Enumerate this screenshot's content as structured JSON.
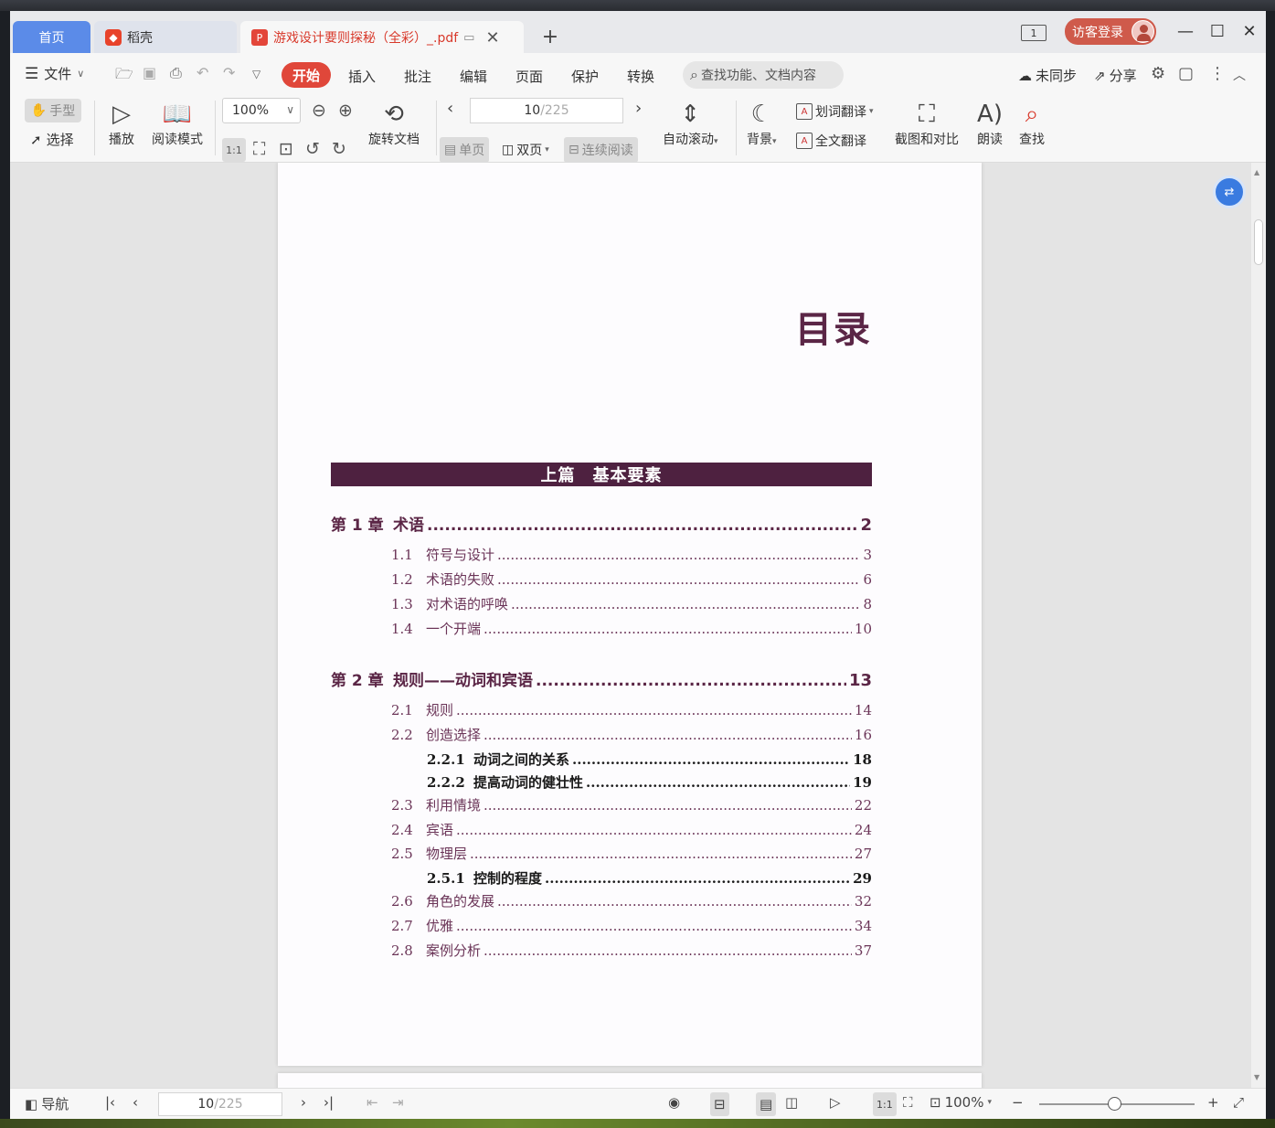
{
  "titlebar": {
    "home_tab": "首页",
    "daoke_tab": "稻壳",
    "doc_tab": "游戏设计要则探秘（全彩）_.pdf",
    "page_count_badge": "1",
    "login_label": "访客登录"
  },
  "menu": {
    "file": "文件",
    "tabs": [
      "开始",
      "插入",
      "批注",
      "编辑",
      "页面",
      "保护",
      "转换"
    ],
    "search_placeholder": "查找功能、文档内容",
    "sync": "未同步",
    "share": "分享"
  },
  "toolbar": {
    "hand": "手型",
    "select": "选择",
    "play": "播放",
    "read_mode": "阅读模式",
    "zoom": "100%",
    "fit_label": "1:1",
    "rotate": "旋转文档",
    "page_current": "10",
    "page_total": "/225",
    "single": "单页",
    "double": "双页",
    "continuous": "连续阅读",
    "autoscroll": "自动滚动",
    "background": "背景",
    "word_translate": "划词翻译",
    "full_translate": "全文翻译",
    "screenshot_compare": "截图和对比",
    "read_aloud": "朗读",
    "find": "查找"
  },
  "document": {
    "toc_title": "目录",
    "part_title": "上篇　基本要素",
    "chapters": [
      {
        "num": "第 1 章",
        "title": "术语",
        "page": "2"
      },
      {
        "num": "第 2 章",
        "title": "规则——动词和宾语",
        "page": "13"
      }
    ],
    "sections": [
      {
        "num": "1.1",
        "title": "符号与设计",
        "page": "3"
      },
      {
        "num": "1.2",
        "title": "术语的失败",
        "page": "6"
      },
      {
        "num": "1.3",
        "title": "对术语的呼唤",
        "page": "8"
      },
      {
        "num": "1.4",
        "title": "一个开端",
        "page": "10"
      },
      {
        "num": "2.1",
        "title": "规则",
        "page": "14"
      },
      {
        "num": "2.2",
        "title": "创造选择",
        "page": "16"
      },
      {
        "num": "2.2.1",
        "title": "动词之间的关系",
        "page": "18"
      },
      {
        "num": "2.2.2",
        "title": "提高动词的健壮性",
        "page": "19"
      },
      {
        "num": "2.3",
        "title": "利用情境",
        "page": "22"
      },
      {
        "num": "2.4",
        "title": "宾语",
        "page": "24"
      },
      {
        "num": "2.5",
        "title": "物理层",
        "page": "27"
      },
      {
        "num": "2.5.1",
        "title": "控制的程度",
        "page": "29"
      },
      {
        "num": "2.6",
        "title": "角色的发展",
        "page": "32"
      },
      {
        "num": "2.7",
        "title": "优雅",
        "page": "34"
      },
      {
        "num": "2.8",
        "title": "案例分析",
        "page": "37"
      }
    ]
  },
  "statusbar": {
    "nav": "导航",
    "page_current": "10",
    "page_total": "/225",
    "fit_label": "1:1",
    "zoom": "100%"
  },
  "colors": {
    "accent_red": "#e0473a",
    "home_tab_blue": "#5b8be8",
    "toc_purple": "#5b2646"
  }
}
